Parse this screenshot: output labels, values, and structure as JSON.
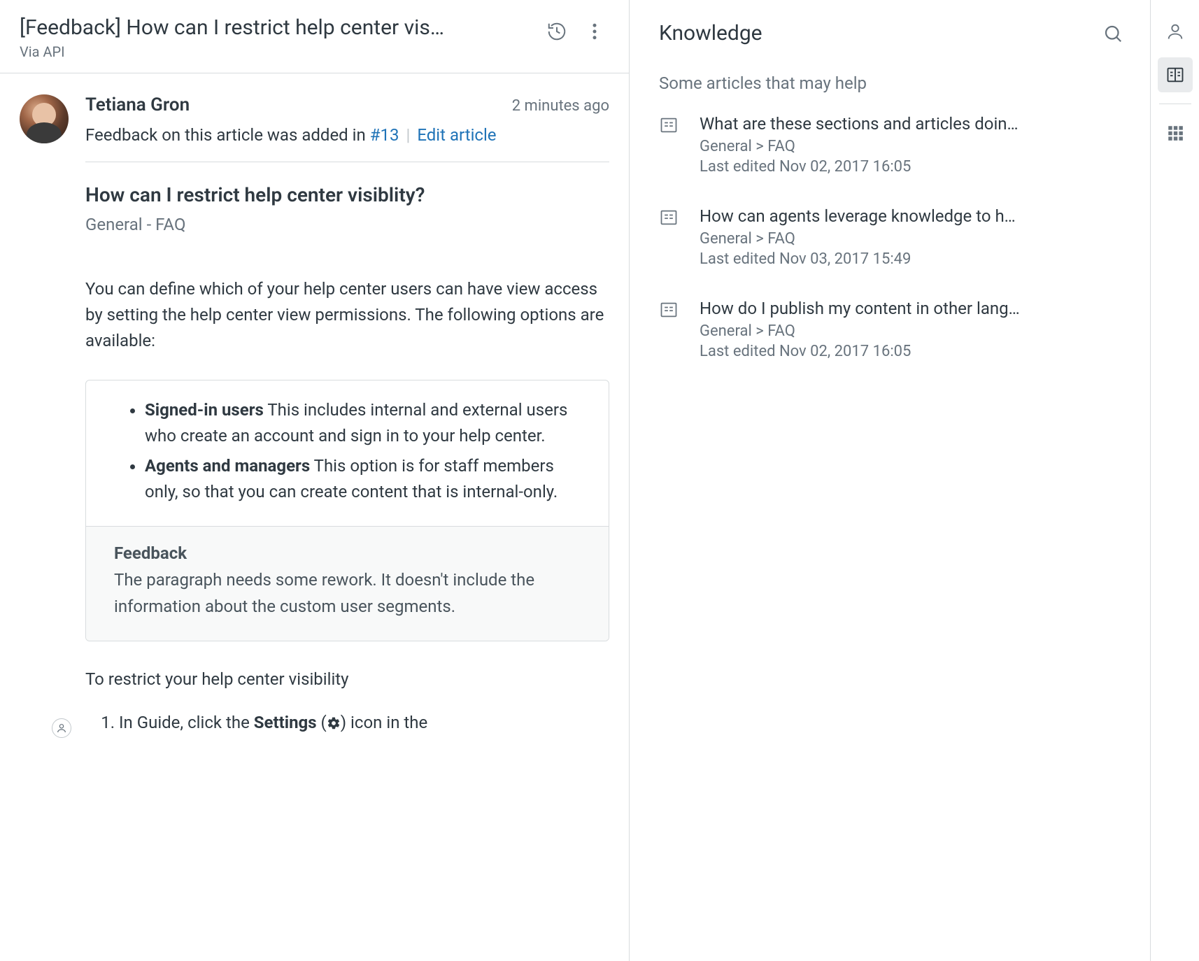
{
  "header": {
    "title": "[Feedback] How can I restrict help center vis…",
    "via": "Via API"
  },
  "comment": {
    "author": "Tetiana Gron",
    "time": "2 minutes ago",
    "feedback_prefix": "Feedback on this article was added in ",
    "feedback_link": "#13",
    "edit_link": "Edit article"
  },
  "article": {
    "title": "How can I restrict help center visiblity?",
    "path": "General - FAQ",
    "intro": "You can define which of your help center users can have view access by setting the help center view permissions. The following options are available:",
    "options": [
      {
        "label": "Signed-in users",
        "text": " This includes internal and external users who create an account and sign in to your help center."
      },
      {
        "label": "Agents and managers",
        "text": " This option is for staff members only, so that you can create content that is internal-only."
      }
    ],
    "feedback": {
      "heading": "Feedback",
      "text": "The paragraph needs some rework. It doesn't include the information about the custom user segments."
    },
    "steps_intro": "To restrict your help center visibility",
    "step1_a": "In Guide, click the ",
    "step1_b": "Settings",
    "step1_c": " (",
    "step1_d": ") icon in the"
  },
  "knowledge": {
    "title": "Knowledge",
    "subtitle": "Some articles that may help",
    "items": [
      {
        "title": "What are these sections and articles doin…",
        "path": "General > FAQ",
        "edited": "Last edited Nov 02, 2017 16:05"
      },
      {
        "title": "How can agents leverage knowledge to h…",
        "path": "General > FAQ",
        "edited": "Last edited Nov 03, 2017 15:49"
      },
      {
        "title": "How do I publish my content in other lang…",
        "path": "General > FAQ",
        "edited": "Last edited Nov 02, 2017 16:05"
      }
    ]
  }
}
